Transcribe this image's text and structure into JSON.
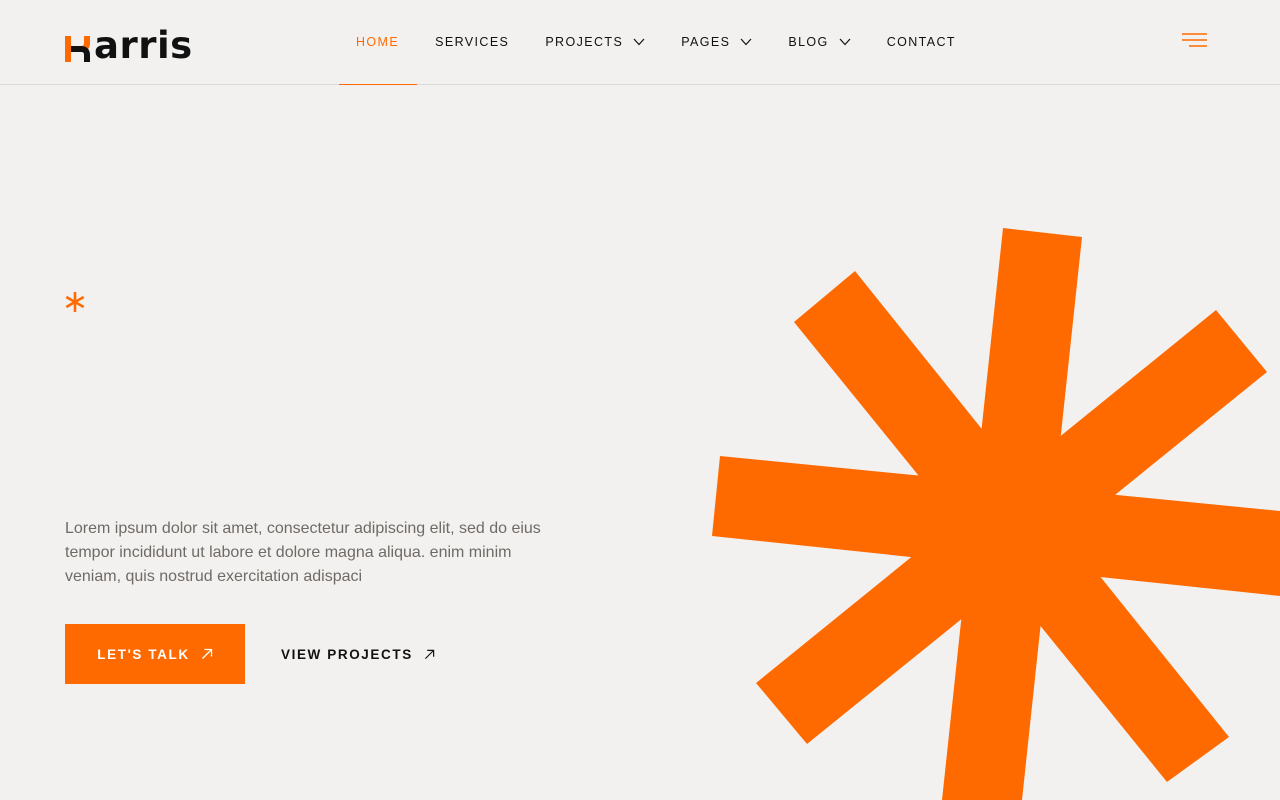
{
  "brand": {
    "name": "arris",
    "accent_color": "#ff6a00"
  },
  "nav": {
    "items": [
      {
        "label": "HOME",
        "active": true,
        "has_dropdown": false
      },
      {
        "label": "SERVICES",
        "active": false,
        "has_dropdown": false
      },
      {
        "label": "PROJECTS",
        "active": false,
        "has_dropdown": true
      },
      {
        "label": "PAGES",
        "active": false,
        "has_dropdown": true
      },
      {
        "label": "BLOG",
        "active": false,
        "has_dropdown": true
      },
      {
        "label": "CONTACT",
        "active": false,
        "has_dropdown": false
      }
    ],
    "dropdown_icon": "chevron-down-icon",
    "menu_icon": "hamburger-menu-icon"
  },
  "hero": {
    "accent_icon": "asterisk-icon",
    "description": "Lorem ipsum dolor sit amet, consectetur adipiscing elit, sed do eius tempor incididunt ut labore et dolore magna aliqua. enim minim veniam, quis nostrud exercitation adispaci",
    "primary_button": {
      "label": "LET'S TALK",
      "icon": "arrow-up-right-icon"
    },
    "secondary_button": {
      "label": "VIEW PROJECTS",
      "icon": "arrow-up-right-icon"
    },
    "decoration_icon": "large-asterisk-icon"
  }
}
